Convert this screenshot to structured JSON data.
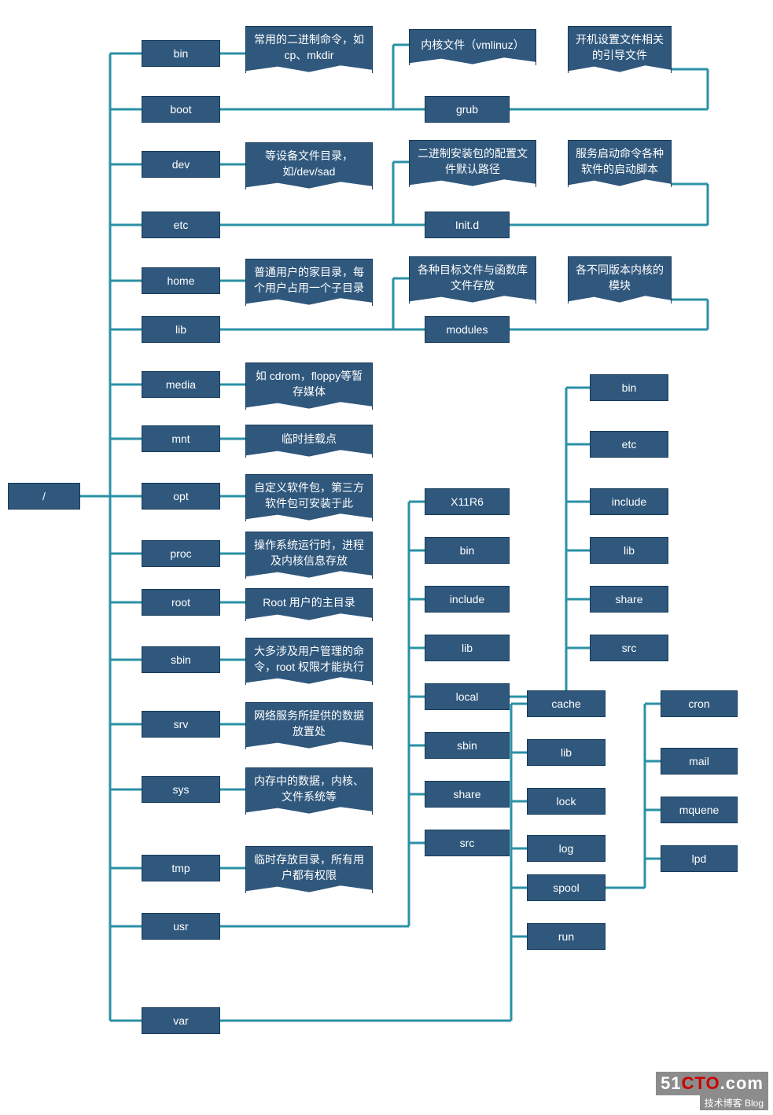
{
  "root": "/",
  "col1": {
    "bin": "bin",
    "boot": "boot",
    "dev": "dev",
    "etc": "etc",
    "home": "home",
    "lib": "lib",
    "media": "media",
    "mnt": "mnt",
    "opt": "opt",
    "proc": "proc",
    "root": "root",
    "sbin": "sbin",
    "srv": "srv",
    "sys": "sys",
    "tmp": "tmp",
    "usr": "usr",
    "var": "var"
  },
  "notes": {
    "bin": "常用的二进制命令，如 cp、mkdir",
    "dev": "等设备文件目录，如/dev/sad",
    "home": "普通用户的家目录，每个用户占用一个子目录",
    "media": "如 cdrom，floppy等暂存媒体",
    "mnt": "临时挂载点",
    "opt": "自定义软件包，第三方软件包可安装于此",
    "proc": "操作系统运行时，进程及内核信息存放",
    "root": "Root 用户的主目录",
    "sbin": "大多涉及用户管理的命令，root 权限才能执行",
    "srv": "网络服务所提供的数据放置处",
    "sys": "内存中的数据，内核、文件系统等",
    "tmp": "临时存放目录，所有用户都有权限",
    "boot_kernel": "内核文件（vmlinuz）",
    "boot_grub_note": "开机设置文件相关的引导文件",
    "etc_init_note": "二进制安装包的配置文件默认路径",
    "etc_init_note2": "服务启动命令各种软件的启动脚本",
    "lib_modules_note": "各种目标文件与函数库文件存放",
    "lib_modules_note2": "各不同版本内核的模块"
  },
  "boot": {
    "grub": "grub"
  },
  "etc": {
    "initd": "Init.d"
  },
  "lib": {
    "modules": "modules"
  },
  "usr": {
    "x11r6": "X11R6",
    "bin": "bin",
    "include": "include",
    "lib": "lib",
    "local": "local",
    "sbin": "sbin",
    "share": "share",
    "src": "src"
  },
  "local": {
    "bin": "bin",
    "etc": "etc",
    "include": "include",
    "lib": "lib",
    "share": "share",
    "src": "src"
  },
  "var": {
    "cache": "cache",
    "lib": "lib",
    "lock": "lock",
    "log": "log",
    "spool": "spool",
    "run": "run"
  },
  "spool": {
    "cron": "cron",
    "mail": "mail",
    "mquene": "mquene",
    "lpd": "lpd"
  },
  "watermark": {
    "site": "51CTO.com",
    "tag": "技术博客 Blog"
  }
}
